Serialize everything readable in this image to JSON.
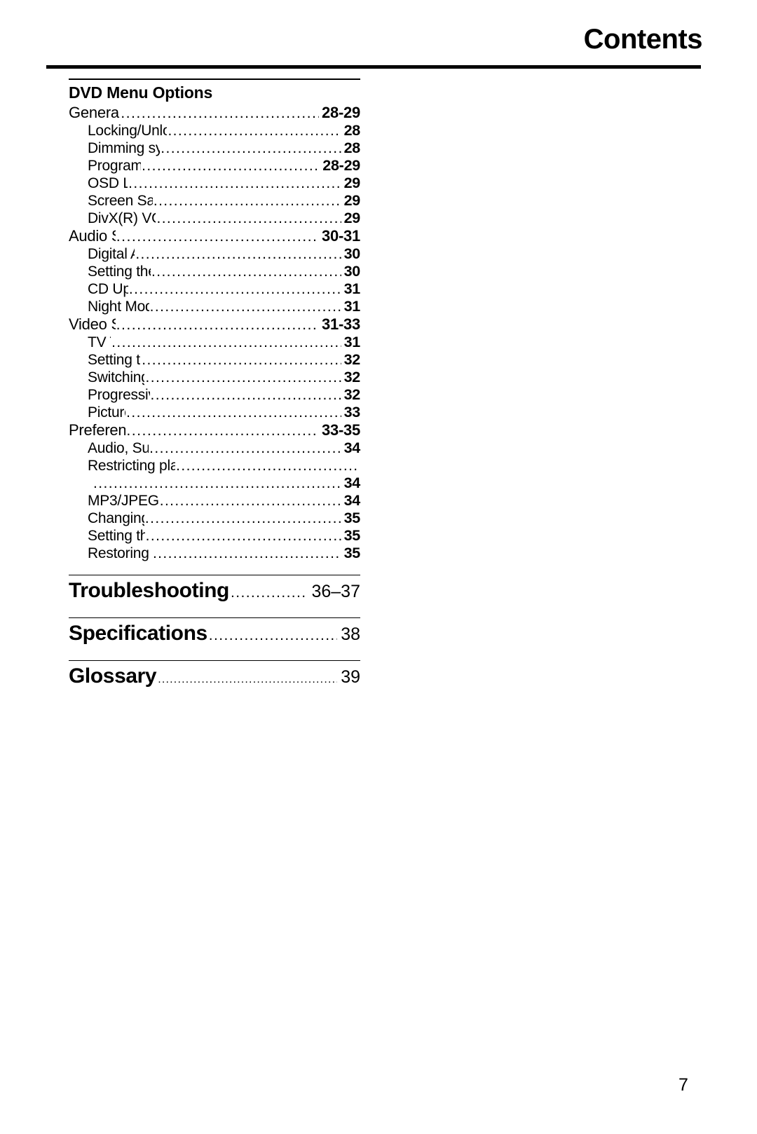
{
  "header": {
    "title": "Contents"
  },
  "toc": {
    "group_heading": "DVD Menu Options",
    "entries": [
      {
        "level": 1,
        "title": "General Setup menu",
        "page": "28-29"
      },
      {
        "level": 2,
        "title": "Locking/Unlocking the disc for viewing",
        "page": "28"
      },
      {
        "level": 2,
        "title": "Dimming system's display screen",
        "page": "28"
      },
      {
        "level": 2,
        "title": "Programming disc tracks",
        "page": "28-29"
      },
      {
        "level": 2,
        "title": "OSD Language",
        "page": "29"
      },
      {
        "level": 2,
        "title": "Screen Saver - turning on/off",
        "page": "29"
      },
      {
        "level": 2,
        "title": "DivX(R) VOD registration code",
        "page": "29"
      },
      {
        "level": 1,
        "title": "Audio Setup Menu",
        "page": "30-31"
      },
      {
        "level": 2,
        "title": "Digital Audio Setup",
        "page": "30"
      },
      {
        "level": 2,
        "title": "Setting the analogue output",
        "page": "30"
      },
      {
        "level": 2,
        "title": "CD Upsampling",
        "page": "31"
      },
      {
        "level": 2,
        "title": "Night Mode - turning on/off",
        "page": "31"
      },
      {
        "level": 1,
        "title": "Video Setup Menu",
        "page": "31-33"
      },
      {
        "level": 2,
        "title": "TV Type",
        "page": "31"
      },
      {
        "level": 2,
        "title": "Setting the TV Display",
        "page": "32"
      },
      {
        "level": 2,
        "title": "Switching the YUV/RGB",
        "page": "32"
      },
      {
        "level": 2,
        "title": "Progressive - turning on/off",
        "page": "32"
      },
      {
        "level": 2,
        "title": "Picture Setting",
        "page": "33"
      },
      {
        "level": 1,
        "title": "Preference Setup Menu",
        "page": "33-35"
      },
      {
        "level": 2,
        "title": "Audio, Subtitle, Disc Menu",
        "page": "34"
      },
      {
        "level": 2,
        "title": "Restricting playback by Parental Control",
        "page": ""
      },
      {
        "level": "continuation",
        "title": "",
        "page": "34"
      },
      {
        "level": 2,
        "title": "MP3/JPEG Menu - turning on/off",
        "page": "34"
      },
      {
        "level": 2,
        "title": "Changing the Password",
        "page": "35"
      },
      {
        "level": 2,
        "title": "Setting the DivX Subtitle",
        "page": "35"
      },
      {
        "level": 2,
        "title": "Restoring to original settings",
        "page": "35"
      }
    ],
    "sections": [
      {
        "title": "Troubleshooting",
        "page": "36–37"
      },
      {
        "title": "Specifications",
        "page": "38"
      },
      {
        "title": "Glossary",
        "page": "39"
      }
    ]
  },
  "footer": {
    "page_number": "7"
  }
}
